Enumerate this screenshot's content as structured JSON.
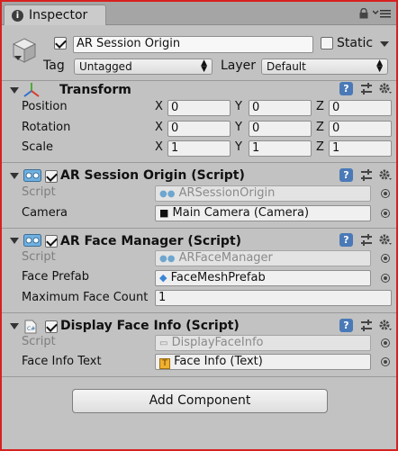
{
  "tab": {
    "title": "Inspector"
  },
  "gameobject": {
    "name": "AR Session Origin",
    "static_label": "Static",
    "tag_label": "Tag",
    "tag_value": "Untagged",
    "layer_label": "Layer",
    "layer_value": "Default"
  },
  "transform": {
    "title": "Transform",
    "position": {
      "label": "Position",
      "x": "0",
      "y": "0",
      "z": "0"
    },
    "rotation": {
      "label": "Rotation",
      "x": "0",
      "y": "0",
      "z": "0"
    },
    "scale": {
      "label": "Scale",
      "x": "1",
      "y": "1",
      "z": "1"
    },
    "axis": {
      "x": "X",
      "y": "Y",
      "z": "Z"
    }
  },
  "ar_session_origin": {
    "title": "AR Session Origin (Script)",
    "script_label": "Script",
    "script_value": "ARSessionOrigin",
    "camera_label": "Camera",
    "camera_value": "Main Camera (Camera)"
  },
  "ar_face_manager": {
    "title": "AR Face Manager (Script)",
    "script_label": "Script",
    "script_value": "ARFaceManager",
    "prefab_label": "Face Prefab",
    "prefab_value": "FaceMeshPrefab",
    "max_label": "Maximum Face Count",
    "max_value": "1"
  },
  "display_face_info": {
    "title": "Display Face Info (Script)",
    "script_label": "Script",
    "script_value": "DisplayFaceInfo",
    "text_label": "Face Info Text",
    "text_value": "Face Info (Text)"
  },
  "add_component": "Add Component",
  "colors": {
    "accent_border": "#d82020",
    "help_blue": "#4a79b8"
  }
}
